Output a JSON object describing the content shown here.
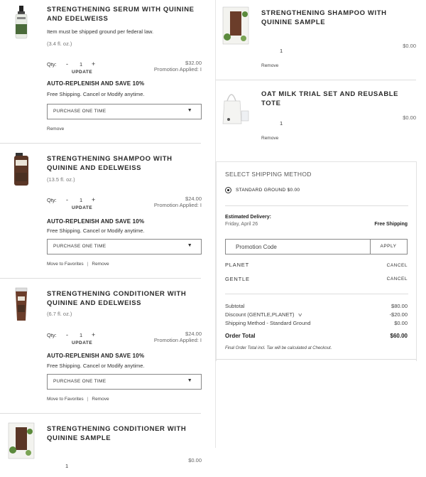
{
  "cart": {
    "items": [
      {
        "title": "STRENGTHENING SERUM WITH QUININE AND EDELWEISS",
        "note": "Item must be shipped ground per federal law.",
        "size": "(3.4 fl. oz.)",
        "qty_label": "Qty:",
        "qty": "1",
        "update_label": "UPDATE",
        "price": "$32.00",
        "promo": "Promotion Applied: I",
        "ar_title": "AUTO-REPLENISH AND SAVE 10%",
        "ar_sub": "Free Shipping. Cancel or Modify anytime.",
        "purchase_option": "PURCHASE ONE TIME",
        "remove_label": "Remove"
      },
      {
        "title": "STRENGTHENING SHAMPOO WITH QUININE AND EDELWEISS",
        "size": "(13.5 fl. oz.)",
        "qty_label": "Qty:",
        "qty": "1",
        "update_label": "UPDATE",
        "price": "$24.00",
        "promo": "Promotion Applied: I",
        "ar_title": "AUTO-REPLENISH AND SAVE 10%",
        "ar_sub": "Free Shipping. Cancel or Modify anytime.",
        "purchase_option": "PURCHASE ONE TIME",
        "favorites_label": "Move to Favorites",
        "remove_label": "Remove"
      },
      {
        "title": "STRENGTHENING CONDITIONER WITH QUININE AND EDELWEISS",
        "size": "(6.7 fl. oz.)",
        "qty_label": "Qty:",
        "qty": "1",
        "update_label": "UPDATE",
        "price": "$24.00",
        "promo": "Promotion Applied: I",
        "ar_title": "AUTO-REPLENISH AND SAVE 10%",
        "ar_sub": "Free Shipping. Cancel or Modify anytime.",
        "purchase_option": "PURCHASE ONE TIME",
        "favorites_label": "Move to Favorites",
        "remove_label": "Remove"
      },
      {
        "title": "STRENGTHENING CONDITIONER WITH QUININE SAMPLE",
        "qty": "1",
        "price": "$0.00"
      }
    ],
    "samples": [
      {
        "title": "STRENGTHENING SHAMPOO WITH QUININE SAMPLE",
        "qty": "1",
        "price": "$0.00",
        "remove_label": "Remove"
      },
      {
        "title": "OAT MILK TRIAL SET AND REUSABLE TOTE",
        "qty": "1",
        "price": "$0.00",
        "remove_label": "Remove"
      }
    ],
    "pipe": "|",
    "select_arrow": "▼"
  },
  "summary": {
    "shipping_heading": "SELECT SHIPPING METHOD",
    "shipping_option": "STANDARD GROUND $0.00",
    "est_label": "Estimated Delivery:",
    "est_date": "Friday, April 26",
    "free_shipping": "Free Shipping",
    "promo_placeholder": "Promotion Code",
    "apply_label": "APPLY",
    "codes": [
      {
        "code": "PLANET",
        "cancel": "CANCEL"
      },
      {
        "code": "GENTLE",
        "cancel": "CANCEL"
      }
    ],
    "subtotal_label": "Subtotal",
    "subtotal": "$80.00",
    "discount_label": "Discount (GENTLE,PLANET)",
    "discount": "-$20.00",
    "shipping_label": "Shipping Method - Standard Ground",
    "shipping": "$0.00",
    "total_label": "Order Total",
    "total": "$60.00",
    "final_note": "Final Order Total incl. Tax will be calculated at Checkout."
  },
  "colors": {
    "text": "#333333",
    "border": "#dddddd",
    "product_green": "#4a6b3a",
    "product_brown": "#5a3626"
  }
}
